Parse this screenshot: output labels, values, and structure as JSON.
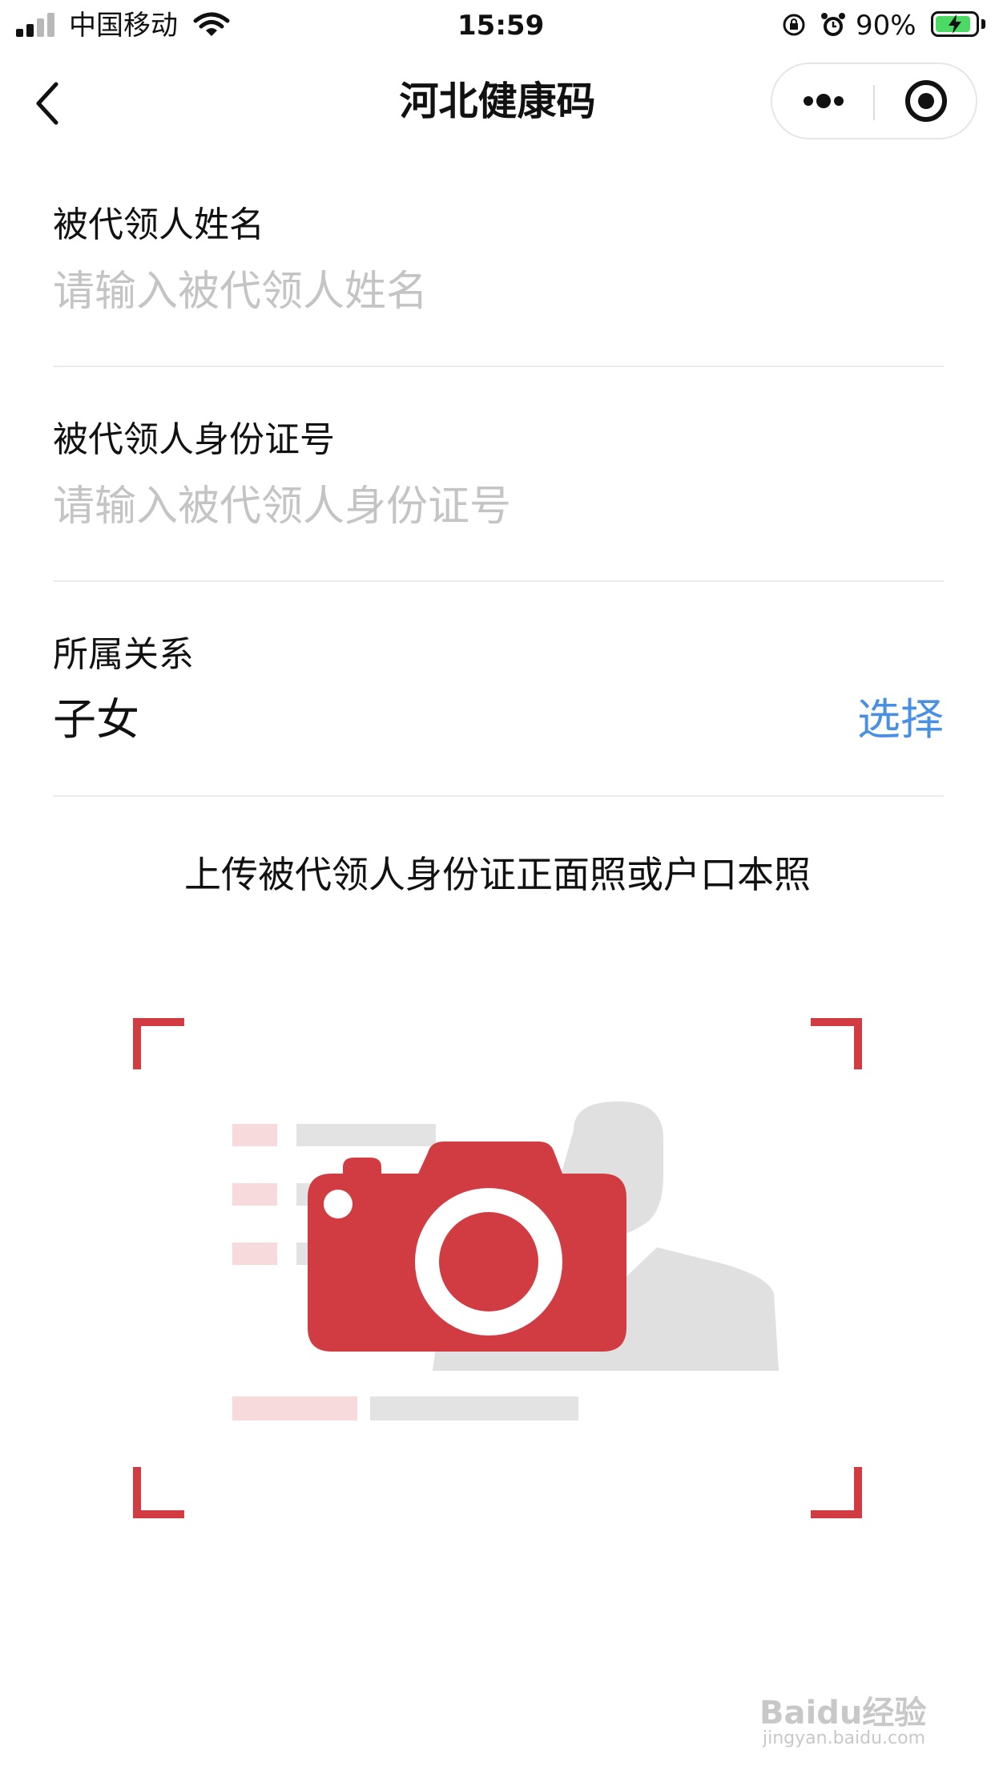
{
  "status_bar": {
    "carrier": "中国移动",
    "time": "15:59",
    "battery_percent": "90%",
    "battery_level": 0.9
  },
  "nav": {
    "title": "河北健康码",
    "back_icon": "chevron-left-icon",
    "more_icon": "more-dots-icon",
    "close_icon": "target-close-icon"
  },
  "form": {
    "name": {
      "label": "被代领人姓名",
      "value": "",
      "placeholder": "请输入被代领人姓名"
    },
    "id_number": {
      "label": "被代领人身份证号",
      "value": "",
      "placeholder": "请输入被代领人身份证号"
    },
    "relation": {
      "label": "所属关系",
      "value": "子女",
      "select_label": "选择"
    }
  },
  "upload": {
    "title": "上传被代领人身份证正面照或户口本照",
    "icon": "camera-icon"
  },
  "colors": {
    "accent_red": "#d13c42",
    "link_blue": "#4a90e2",
    "placeholder_gray": "#c4c4c4"
  },
  "watermark": {
    "text": "Baidu经验",
    "subtext": "jingyan.baidu.com"
  }
}
